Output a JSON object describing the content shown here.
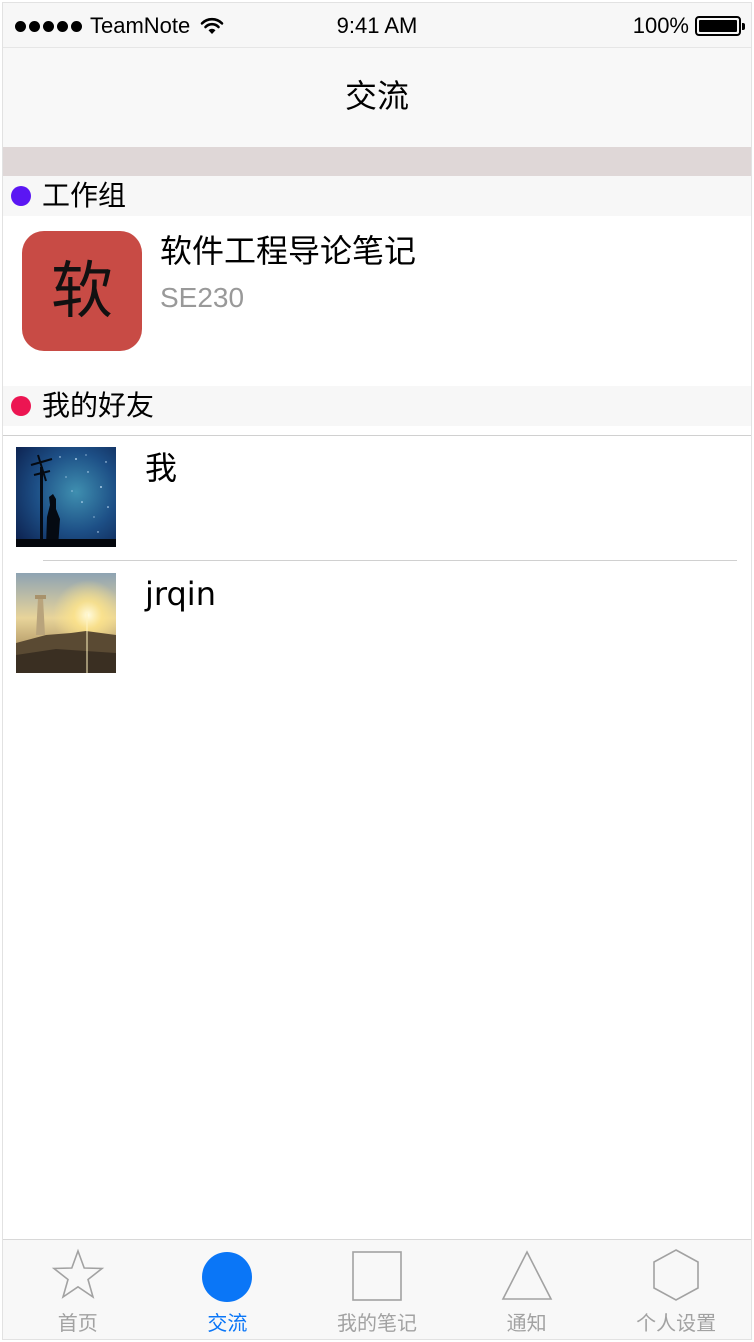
{
  "status_bar": {
    "carrier": "TeamNote",
    "time": "9:41 AM",
    "battery": "100%"
  },
  "nav": {
    "title": "交流"
  },
  "sections": [
    {
      "title": "工作组",
      "dot_color": "#5b16f3"
    },
    {
      "title": "我的好友",
      "dot_color": "#ec1552"
    }
  ],
  "group": {
    "icon_char": "软",
    "icon_color": "#c84b45",
    "name": "软件工程导论笔记",
    "code": "SE230"
  },
  "friends": [
    {
      "name": "我",
      "avatar": "starry-night-silhouette"
    },
    {
      "name": "jrqin",
      "avatar": "sunset-tower"
    }
  ],
  "tabs": [
    {
      "label": "首页",
      "icon": "star-icon"
    },
    {
      "label": "交流",
      "icon": "circle-icon",
      "active": true
    },
    {
      "label": "我的笔记",
      "icon": "square-icon"
    },
    {
      "label": "通知",
      "icon": "triangle-icon"
    },
    {
      "label": "个人设置",
      "icon": "hexagon-icon"
    }
  ],
  "colors": {
    "accent": "#0a76f7",
    "inactive": "#a2a2a2",
    "band": "#dfd7d7"
  }
}
